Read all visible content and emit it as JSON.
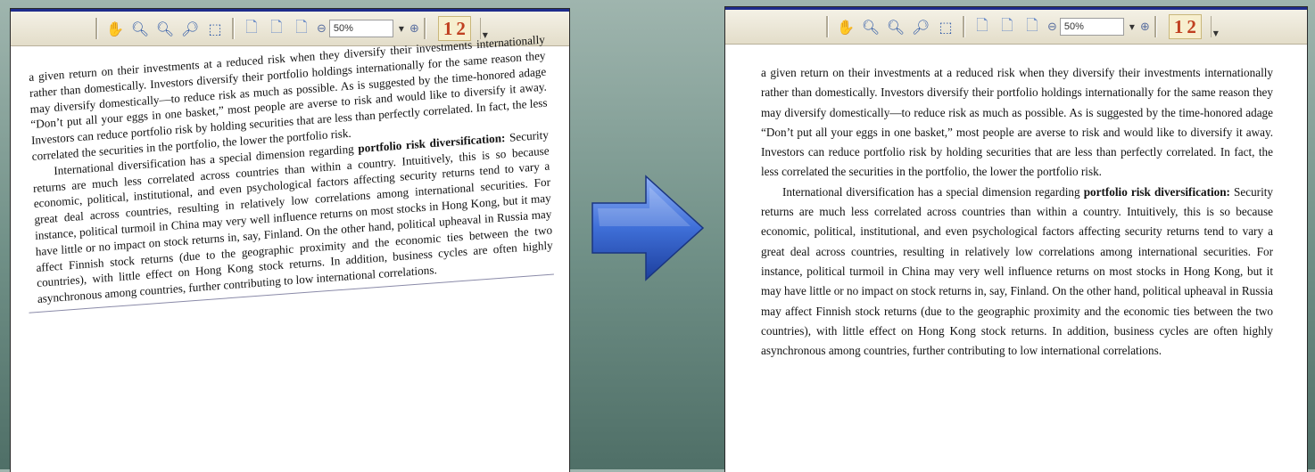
{
  "toolbar": {
    "zoom_value": "50%",
    "page_indicator": [
      "1",
      "2"
    ],
    "icons": [
      "hand-icon",
      "zoom-in-icon",
      "zoom-out-icon",
      "zoom-area-icon",
      "select-area-icon",
      "single-page-icon",
      "continuous-page-icon",
      "facing-page-icon",
      "zoom-minus-icon",
      "zoom-dropdown-icon",
      "zoom-plus-icon"
    ]
  },
  "document": {
    "para1": "a given return on their investments at a reduced risk when they diversify their investments internationally rather than domestically. Investors diversify their portfolio holdings internationally for the same reason they may diversify domestically—to reduce risk as much as possible. As is suggested by the time-honored adage “Don’t put all your eggs in one basket,” most people are averse to risk and would like to diversify it away. Investors can reduce portfolio risk by holding securities that are less than perfectly correlated. In fact, the less correlated the securities in the portfolio, the lower the portfolio risk.",
    "para2_lead": "International diversification has a special dimension regarding ",
    "para2_term": "portfolio risk diversification:",
    "para2_body": " Security returns are much less correlated across countries than within a country. Intuitively, this is so because economic, political, institutional, and even psychological factors affecting security returns tend to vary a great deal across countries, resulting in relatively low correlations among international securities. For instance, political turmoil in China may very well influence returns on most stocks in Hong Kong, but it may have little or no impact on stock returns in, say, Finland. On the other hand, political upheaval in Russia may affect Finnish stock returns (due to the geographic proximity and the economic ties between the two countries), with little effect on Hong Kong stock returns. In addition, business cycles are often highly asynchronous among countries, further contributing to low international correlations."
  },
  "colors": {
    "arrow": "#3f6fd8",
    "toolbar_icon": "#2f5aa8",
    "page_indicator": "#c04020",
    "panel_border": "#1e2c8c"
  }
}
